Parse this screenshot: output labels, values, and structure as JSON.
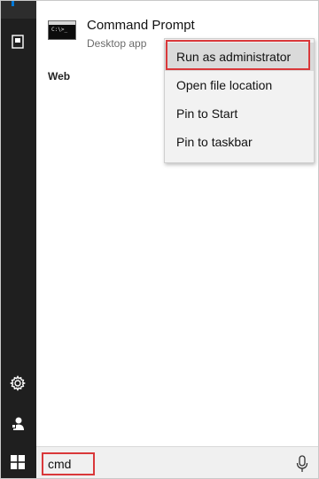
{
  "result": {
    "title": "Command Prompt",
    "subtitle": "Desktop app",
    "thumb_text": "C:\\>_"
  },
  "sections": {
    "web_label": "Web"
  },
  "context_menu": {
    "items": [
      {
        "label": "Run as administrator",
        "highlighted": true
      },
      {
        "label": "Open file location"
      },
      {
        "label": "Pin to Start"
      },
      {
        "label": "Pin to taskbar"
      }
    ]
  },
  "search": {
    "value": "cmd"
  },
  "icons": {
    "rail": [
      "documents-icon",
      "settings-icon",
      "user-icon"
    ],
    "start": "windows-logo-icon",
    "mic": "microphone-icon"
  },
  "colors": {
    "rail": "#1f1f1f",
    "highlight_border": "#d9383a",
    "accent": "#0078d7",
    "menu_bg": "#f2f2f2",
    "menu_hover": "#dadada"
  }
}
